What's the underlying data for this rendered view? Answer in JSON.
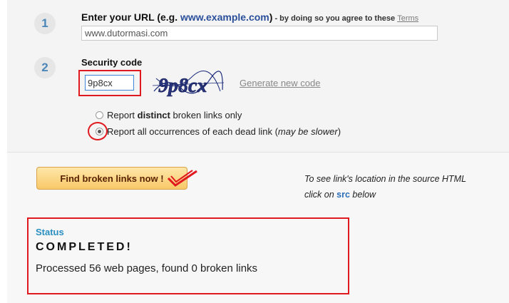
{
  "step1": {
    "number": "1",
    "label": "Enter your URL (e.g. ",
    "example": "www.example.com",
    "label_close": ")",
    "agree_text": " - by doing so you agree to these ",
    "terms_link": "Terms",
    "url_value": "www.dutormasi.com"
  },
  "step2": {
    "number": "2",
    "label": "Security code",
    "code_value": "9p8cx",
    "captcha_text": "9p8cx",
    "generate_link": "Generate new code"
  },
  "options": {
    "distinct_pre": "Report ",
    "distinct_bold": "distinct",
    "distinct_post": " broken links only",
    "all_text": "Report all occurrences of each dead link (",
    "all_italic": "may be slower",
    "all_close": ")",
    "selected": "all"
  },
  "action": {
    "button_label": "Find broken links now !",
    "hint_line1": "To see link's location in the source HTML",
    "hint_line2_pre": "click on ",
    "hint_src": "src",
    "hint_line2_post": " below"
  },
  "status": {
    "label": "Status",
    "value": "COMPLETED!",
    "result": "Processed 56 web pages, found 0 broken links"
  },
  "colors": {
    "annotation_red": "#e0191f",
    "step_blue": "#4a86b8",
    "status_blue": "#2a8fc0",
    "button_fill": "#f8c868"
  }
}
